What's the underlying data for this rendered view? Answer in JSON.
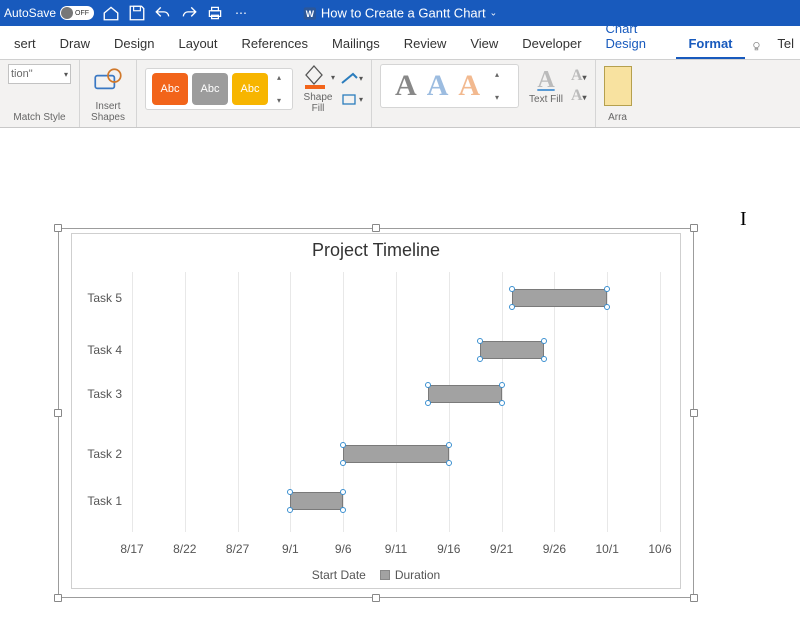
{
  "titlebar": {
    "autosave_label": "AutoSave",
    "autosave_state": "OFF",
    "doc_title": "How to Create a Gantt Chart"
  },
  "ribbon_tabs": {
    "items": [
      "sert",
      "Draw",
      "Design",
      "Layout",
      "References",
      "Mailings",
      "Review",
      "View",
      "Developer",
      "Chart Design",
      "Format",
      "Tel"
    ],
    "active_index": 10,
    "context_start_index": 9
  },
  "ribbon": {
    "group1": {
      "dropdown_text": "tion\"",
      "matchstyle_label": "Match Style"
    },
    "group2": {
      "label": "Insert\nShapes"
    },
    "group3": {
      "fill_label": "Shape\nFill",
      "abc": "Abc"
    },
    "group5": {
      "textfill_label": "Text Fill"
    },
    "group6": {
      "arrange_label": "Arra"
    }
  },
  "chart_data": {
    "type": "bar",
    "title": "Project Timeline",
    "orientation": "horizontal",
    "x_axis": {
      "type": "date",
      "ticks": [
        "8/17",
        "8/22",
        "8/27",
        "9/1",
        "9/6",
        "9/11",
        "9/16",
        "9/21",
        "9/26",
        "10/1",
        "10/6"
      ],
      "tick_values": [
        0,
        5,
        10,
        15,
        20,
        25,
        30,
        35,
        40,
        45,
        50
      ],
      "range": [
        0,
        50
      ]
    },
    "y_axis": {
      "categories": [
        "Task 5",
        "Task 4",
        "Task 3",
        "Task 2",
        "Task 1"
      ],
      "positions_pct": [
        10,
        30,
        47,
        70,
        88
      ]
    },
    "series_visible": "Duration",
    "bars": [
      {
        "task": "Task 1",
        "start": 15,
        "duration": 5,
        "y_idx": 4
      },
      {
        "task": "Task 2",
        "start": 20,
        "duration": 10,
        "y_idx": 3
      },
      {
        "task": "Task 3",
        "start": 28,
        "duration": 7,
        "y_idx": 2
      },
      {
        "task": "Task 4",
        "start": 33,
        "duration": 6,
        "y_idx": 1
      },
      {
        "task": "Task 5",
        "start": 36,
        "duration": 9,
        "y_idx": 0
      }
    ],
    "legend": {
      "items": [
        {
          "label": "Start Date",
          "swatch": false
        },
        {
          "label": "Duration",
          "swatch": true
        }
      ]
    }
  }
}
